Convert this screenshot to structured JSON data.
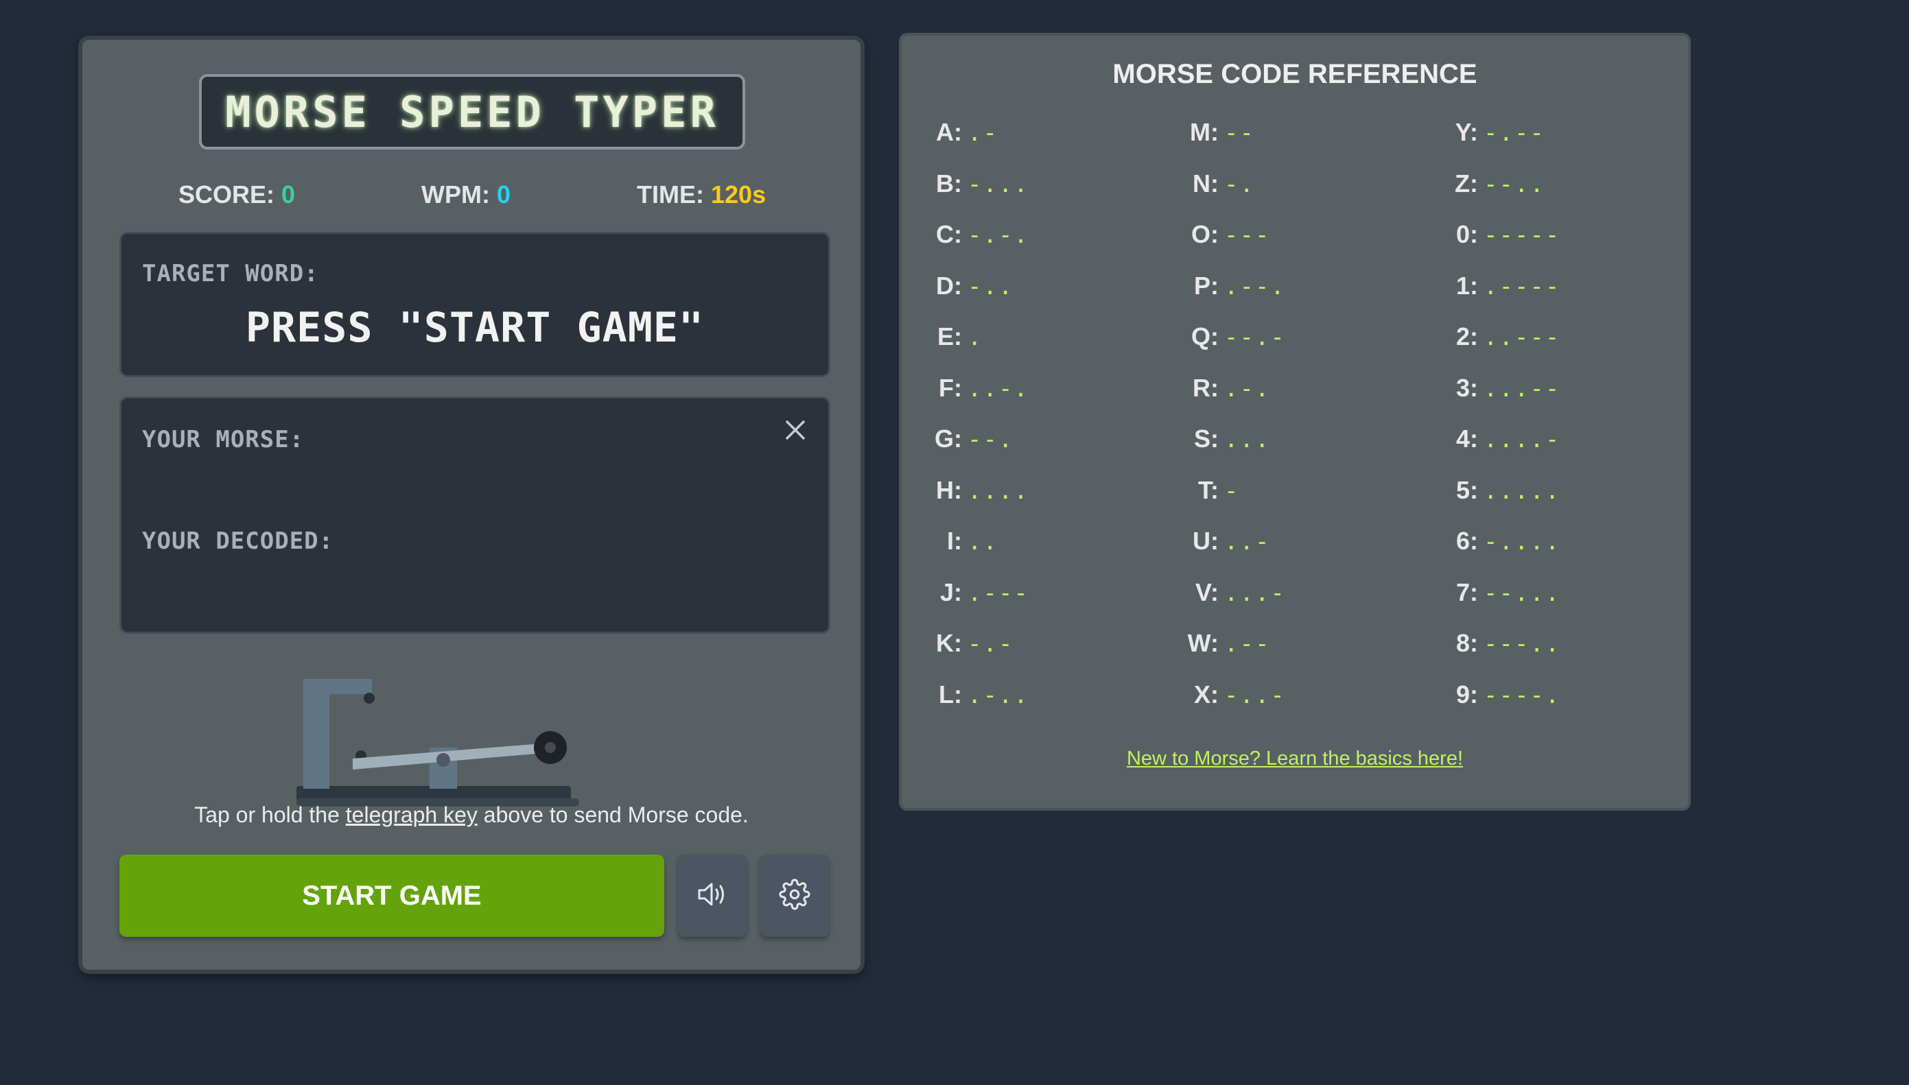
{
  "game": {
    "title": "MORSE SPEED TYPER",
    "stats": {
      "score_label": "SCORE:",
      "score_value": "0",
      "wpm_label": "WPM:",
      "wpm_value": "0",
      "time_label": "TIME:",
      "time_value": "120s"
    },
    "target_label": "TARGET WORD:",
    "target_word": "PRESS \"START GAME\"",
    "morse_label": "YOUR MORSE:",
    "morse_value": "",
    "decoded_label": "YOUR DECODED:",
    "decoded_value": "",
    "instruction_before": "Tap or hold the ",
    "instruction_link": "telegraph key",
    "instruction_after": " above to send Morse code.",
    "start_button": "START GAME",
    "icons": {
      "close": "close-icon",
      "sound": "speaker-icon",
      "settings": "gear-icon",
      "key": "telegraph-key-icon"
    }
  },
  "reference": {
    "title": "MORSE CODE REFERENCE",
    "columns": [
      [
        {
          "label": "A:",
          "code": ".-"
        },
        {
          "label": "B:",
          "code": "-..."
        },
        {
          "label": "C:",
          "code": "-.-."
        },
        {
          "label": "D:",
          "code": "-.."
        },
        {
          "label": "E:",
          "code": "."
        },
        {
          "label": "F:",
          "code": "..-."
        },
        {
          "label": "G:",
          "code": "--."
        },
        {
          "label": "H:",
          "code": "...."
        },
        {
          "label": "I:",
          "code": ".."
        },
        {
          "label": "J:",
          "code": ".---"
        },
        {
          "label": "K:",
          "code": "-.-"
        },
        {
          "label": "L:",
          "code": ".-.."
        }
      ],
      [
        {
          "label": "M:",
          "code": "--"
        },
        {
          "label": "N:",
          "code": "-."
        },
        {
          "label": "O:",
          "code": "---"
        },
        {
          "label": "P:",
          "code": ".--."
        },
        {
          "label": "Q:",
          "code": "--.-"
        },
        {
          "label": "R:",
          "code": ".-."
        },
        {
          "label": "S:",
          "code": "..."
        },
        {
          "label": "T:",
          "code": "-"
        },
        {
          "label": "U:",
          "code": "..-"
        },
        {
          "label": "V:",
          "code": "...-"
        },
        {
          "label": "W:",
          "code": ".--"
        },
        {
          "label": "X:",
          "code": "-..-"
        }
      ],
      [
        {
          "label": "Y:",
          "code": "-.--"
        },
        {
          "label": "Z:",
          "code": "--.."
        },
        {
          "label": "0:",
          "code": "-----"
        },
        {
          "label": "1:",
          "code": ".----"
        },
        {
          "label": "2:",
          "code": "..---"
        },
        {
          "label": "3:",
          "code": "...--"
        },
        {
          "label": "4:",
          "code": "....-"
        },
        {
          "label": "5:",
          "code": "....."
        },
        {
          "label": "6:",
          "code": "-...."
        },
        {
          "label": "7:",
          "code": "--..."
        },
        {
          "label": "8:",
          "code": "---.."
        },
        {
          "label": "9:",
          "code": "----."
        }
      ]
    ],
    "learn_link": "New to Morse? Learn the basics here!"
  },
  "colors": {
    "background": "#222b3a",
    "panel": "#596064",
    "accent_green": "#65a30d",
    "code_lime": "#bef264",
    "score_green": "#34d399",
    "wpm_cyan": "#22d3ee",
    "time_yellow": "#facc15"
  }
}
